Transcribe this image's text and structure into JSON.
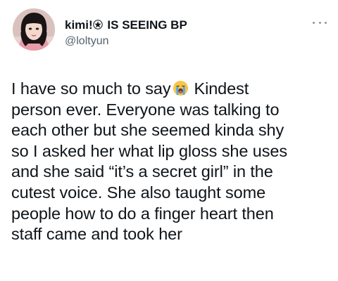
{
  "author": {
    "display_name_part1": "kimi!",
    "display_name_part2": "IS SEEING BP",
    "handle": "@loltyun",
    "star_icon": "star-emblem-icon",
    "avatar_icon": "profile-photo"
  },
  "tweet": {
    "line1_before_emoji": "I have so much to say",
    "emoji": "loudly-crying-face-emoji",
    "line1_after_emoji": "Kindest",
    "line2": "person ever. Everyone was talking to",
    "line3": "each other but she seemed kinda shy",
    "line4": "so I asked her what lip gloss she uses",
    "line5": "and she said “it’s a secret girl” in the",
    "line6": "cutest voice. She also taught some",
    "line7": "people how to do a finger heart then",
    "line8": "staff came and took her"
  },
  "menu": {
    "icon": "more-options-icon"
  },
  "colors": {
    "text": "#0f1419",
    "secondary": "#536471",
    "emoji_face": "#f7c548",
    "tears": "#5aa9e6"
  }
}
